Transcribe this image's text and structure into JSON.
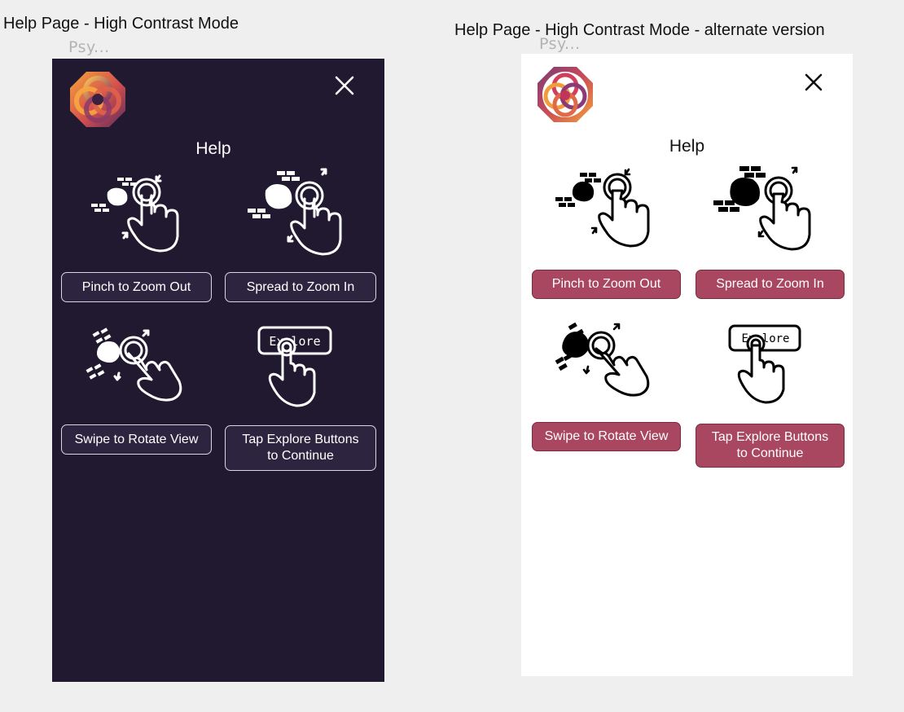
{
  "frames": {
    "left": {
      "title": "Help Page - High Contrast Mode",
      "subtitle": "Psy...",
      "help_title": "Help",
      "buttons": {
        "pinch": "Pinch to Zoom Out",
        "spread": "Spread to Zoom In",
        "swipe": "Swipe to Rotate View",
        "tap": "Tap Explore Buttons\nto Continue"
      },
      "explore_card_text": "Explore",
      "colors": {
        "background": "#21192f",
        "button_fill": "#2d2540",
        "text": "#ffffff"
      }
    },
    "right": {
      "title": "Help Page - High Contrast Mode - alternate version",
      "subtitle": "Psy...",
      "help_title": "Help",
      "buttons": {
        "pinch": "Pinch to Zoom Out",
        "spread": "Spread to Zoom In",
        "swipe": "Swipe to Rotate View",
        "tap": "Tap Explore Buttons\nto Continue"
      },
      "explore_card_text": "Explore",
      "colors": {
        "background": "#ffffff",
        "button_fill": "#a8475f",
        "text": "#ffffff"
      }
    }
  },
  "icons": {
    "logo": "app-logo-octagon",
    "close": "close-icon",
    "pinch": "pinch-gesture-icon",
    "spread": "spread-gesture-icon",
    "swipe": "swipe-rotate-gesture-icon",
    "tap": "tap-explore-gesture-icon"
  }
}
